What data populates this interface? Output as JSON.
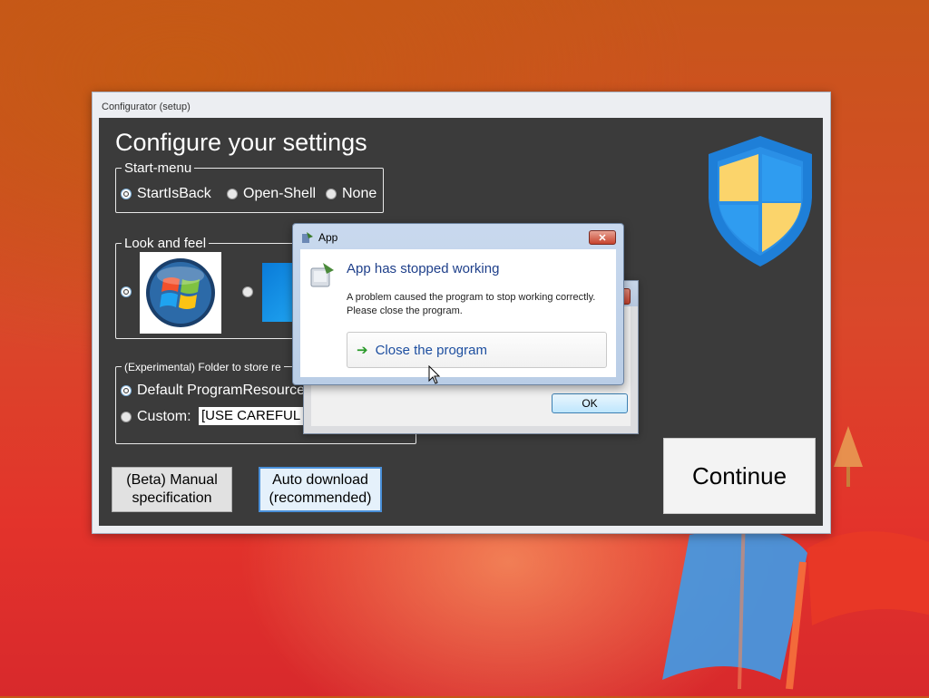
{
  "window": {
    "title": "Configurator (setup)",
    "heading": "Configure your settings"
  },
  "start_menu": {
    "label": "Start-menu",
    "options": [
      "StartIsBack",
      "Open-Shell",
      "None"
    ],
    "selected": "StartIsBack"
  },
  "look_and_feel": {
    "label": "Look and feel",
    "selected": "Windows 7"
  },
  "folder": {
    "label": "(Experimental) Folder to store re",
    "default_label": "Default ProgramResource",
    "custom_label": "Custom:",
    "custom_value": "[USE CAREFUL",
    "selected": "default"
  },
  "buttons": {
    "manual": "(Beta) Manual specification",
    "auto": "Auto download (recommended)",
    "continue": "Continue"
  },
  "crash_dialog": {
    "title": "App",
    "heading": "App has stopped working",
    "message": "A problem caused the program to stop working correctly. Please close the program.",
    "close_program": "Close the program",
    "close_glyph": "✕"
  },
  "back_dialog": {
    "ok": "OK"
  },
  "colors": {
    "shield_blue": "#1e7fd8",
    "shield_yellow": "#fbd46b",
    "window_client": "#3b3b3b"
  }
}
